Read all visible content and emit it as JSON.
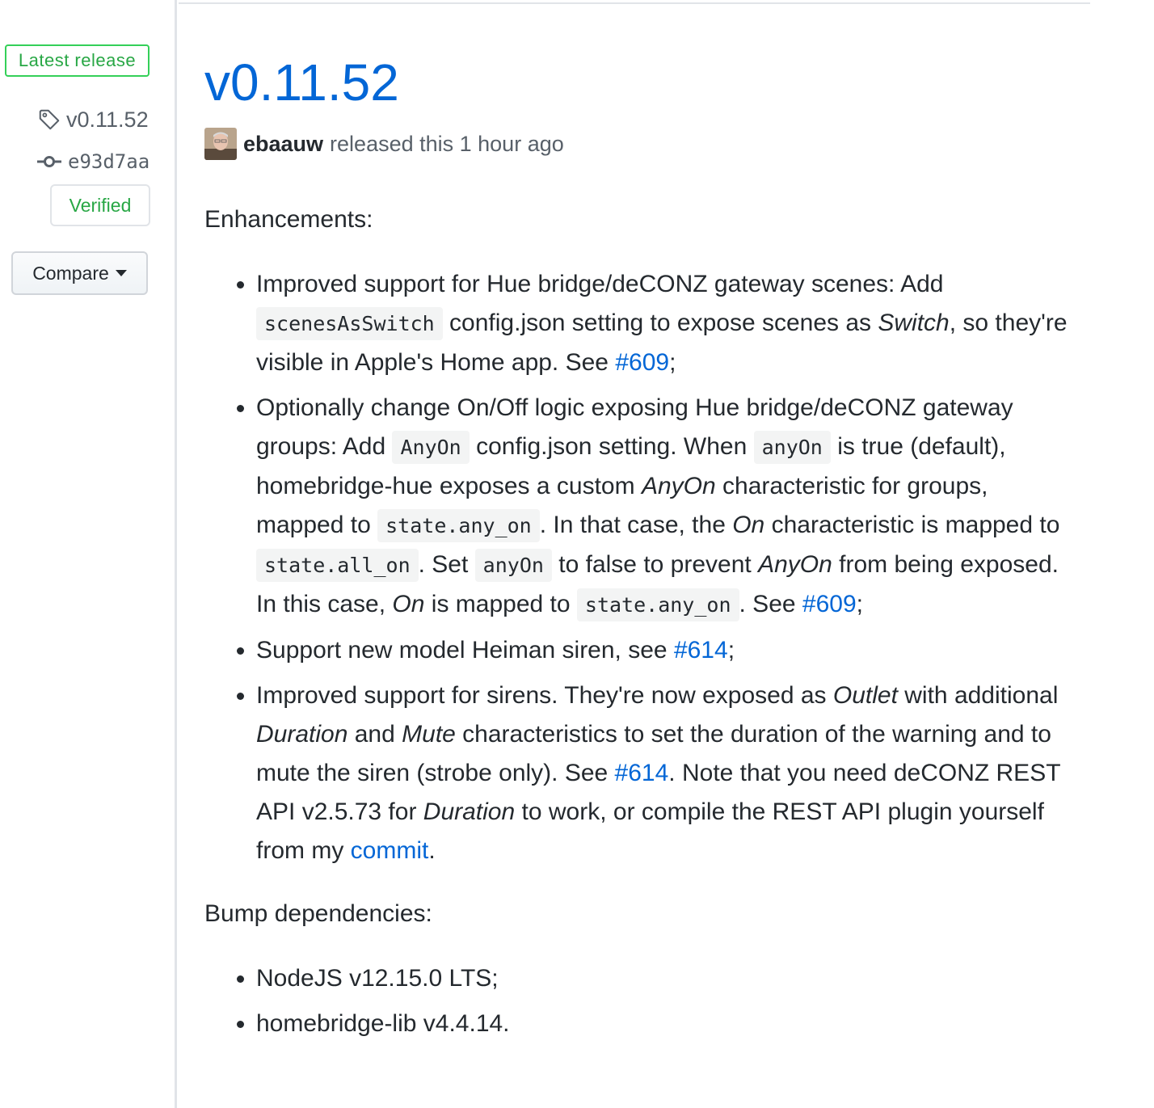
{
  "sidebar": {
    "latest_badge": "Latest release",
    "tag": "v0.11.52",
    "commit": "e93d7aa",
    "verified": "Verified",
    "compare_label": "Compare"
  },
  "release": {
    "title": "v0.11.52",
    "author": "ebaauw",
    "released_text": "released this 1 hour ago"
  },
  "body": {
    "heading_enhancements": "Enhancements:",
    "item1": {
      "t1": "Improved support for Hue bridge/deCONZ gateway scenes: Add ",
      "code1": "scenesAsSwitch",
      "t2": " config.json setting to expose scenes as ",
      "em1": "Switch",
      "t3": ", so they're visible in Apple's Home app. See ",
      "link1": "#609",
      "t4": ";"
    },
    "item2": {
      "t1": "Optionally change On/Off logic exposing Hue bridge/deCONZ gateway groups: Add ",
      "code1": "AnyOn",
      "t2": " config.json setting. When ",
      "code2": "anyOn",
      "t3": " is true (default), homebridge-hue exposes a custom ",
      "em1": "AnyOn",
      "t4": " characteristic for groups, mapped to ",
      "code3": "state.any_on",
      "t5": ". In that case, the ",
      "em2": "On",
      "t6": " characteristic is mapped to ",
      "code4": "state.all_on",
      "t7": ". Set ",
      "code5": "anyOn",
      "t8": " to false to prevent ",
      "em3": "AnyOn",
      "t9": " from being exposed. In this case, ",
      "em4": "On",
      "t10": " is mapped to ",
      "code6": "state.any_on",
      "t11": ". See ",
      "link1": "#609",
      "t12": ";"
    },
    "item3": {
      "t1": "Support new model Heiman siren, see ",
      "link1": "#614",
      "t2": ";"
    },
    "item4": {
      "t1": "Improved support for sirens. They're now exposed as ",
      "em1": "Outlet",
      "t2": " with additional ",
      "em2": "Duration",
      "t3": " and ",
      "em3": "Mute",
      "t4": " characteristics to set the duration of the warning and to mute the siren (strobe only). See ",
      "link1": "#614",
      "t5": ". Note that you need deCONZ REST API v2.5.73 for ",
      "em4": "Duration",
      "t6": " to work, or compile the REST API plugin yourself from my ",
      "link2": "commit",
      "t7": "."
    },
    "heading_deps": "Bump dependencies:",
    "deps": [
      "NodeJS v12.15.0 LTS;",
      "homebridge-lib v4.4.14."
    ]
  },
  "icons": {
    "tag": "tag-icon",
    "commit": "git-commit-icon",
    "caret": "caret-down-icon"
  },
  "colors": {
    "link": "#0366d6",
    "verified": "#28a745",
    "text": "#24292e",
    "muted": "#586069"
  }
}
